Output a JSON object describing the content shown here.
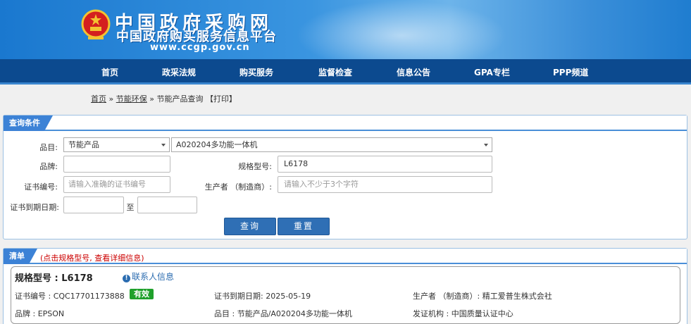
{
  "header": {
    "title": "中国政府采购网",
    "subtitle": "中国政府购买服务信息平台",
    "url": "www.ccgp.gov.cn"
  },
  "nav": [
    "首页",
    "政采法规",
    "购买服务",
    "监督检查",
    "信息公告",
    "GPA专栏",
    "PPP频道"
  ],
  "breadcrumb": {
    "home": "首页",
    "sep1": "»",
    "section": "节能环保",
    "sep2": "»",
    "current": "节能产品查询",
    "print": "【打印】"
  },
  "query": {
    "panel_title": "查询条件",
    "category_label": "品目:",
    "category_value": "节能产品",
    "subcategory_value": "A020204多功能一体机",
    "brand_label": "品牌:",
    "brand_value": "",
    "model_label": "规格型号:",
    "model_value": "L6178",
    "cert_label": "证书编号:",
    "cert_placeholder": "请输入准确的证书编号",
    "maker_label": "生产者 （制造商）:",
    "maker_placeholder": "请输入不少于3个字符",
    "expiry_label": "证书到期日期:",
    "expiry_to": "至",
    "search_button": "查询",
    "reset_button": "重置"
  },
  "results": {
    "panel_title": "清单",
    "hint": "(点击规格型号, 查看详细信息)",
    "items": [
      {
        "model": "规格型号 : L6178",
        "contact": "联系人信息",
        "cert_no": "证书编号 : CQC17701173888",
        "status": "有效",
        "expiry": "证书到期日期: 2025-05-19",
        "maker": "生产者 （制造商）: 精工爱普生株式会社",
        "brand": "品牌 : EPSON",
        "category": "品目 : 节能产品/A020204多功能一体机",
        "issuer": "发证机构 : 中国质量认证中心"
      }
    ]
  },
  "colors": {
    "nav_bg": "#0c4a8f",
    "panel_tab": "#3c82d6",
    "button": "#2f6fb5",
    "status_valid": "#1fa02b",
    "hint_red": "#cc0000"
  }
}
